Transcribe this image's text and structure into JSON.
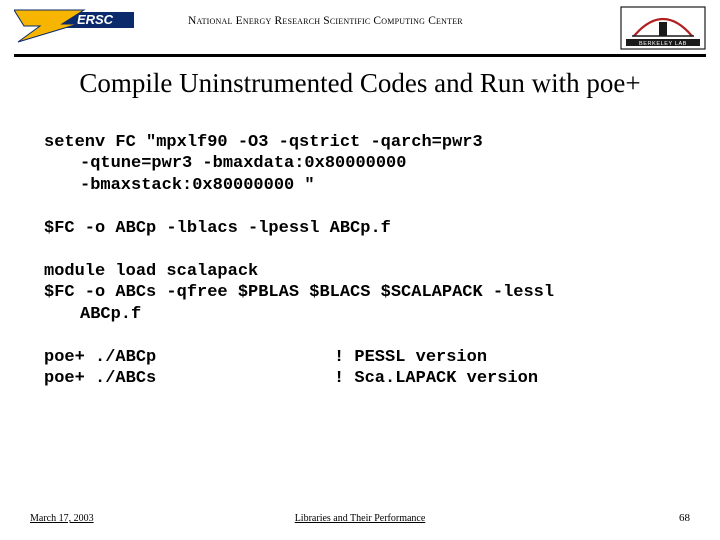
{
  "header": {
    "org_name": "National Energy Research Scientific Computing Center",
    "left_logo_label": "ERSC",
    "right_logo_label": "Berkeley Lab"
  },
  "title": "Compile Uninstrumented Codes and Run with poe+",
  "code": {
    "block1_line1": "setenv FC \"mpxlf90 -O3 -qstrict -qarch=pwr3",
    "block1_line2": "-qtune=pwr3 -bmaxdata:0x80000000",
    "block1_line3": "-bmaxstack:0x80000000 \"",
    "block2_line1": "$FC -o ABCp -lblacs -lpessl ABCp.f",
    "block3_line1": "module load scalapack",
    "block3_line2": "$FC -o ABCs -qfree $PBLAS $BLACS $SCALAPACK -lessl",
    "block3_line3": "ABCp.f",
    "block4_left1": "poe+ ./ABCp",
    "block4_right1": "! PESSL version",
    "block4_left2": "poe+ ./ABCs",
    "block4_right2": "! Sca.LAPACK version"
  },
  "footer": {
    "date": "March 17, 2003",
    "center": "Libraries and Their Performance",
    "page": "68"
  },
  "colors": {
    "nersc_blue": "#0a2a6b",
    "nersc_yellow": "#f7b500",
    "lab_red": "#b02020",
    "lab_border": "#1a1a1a"
  }
}
